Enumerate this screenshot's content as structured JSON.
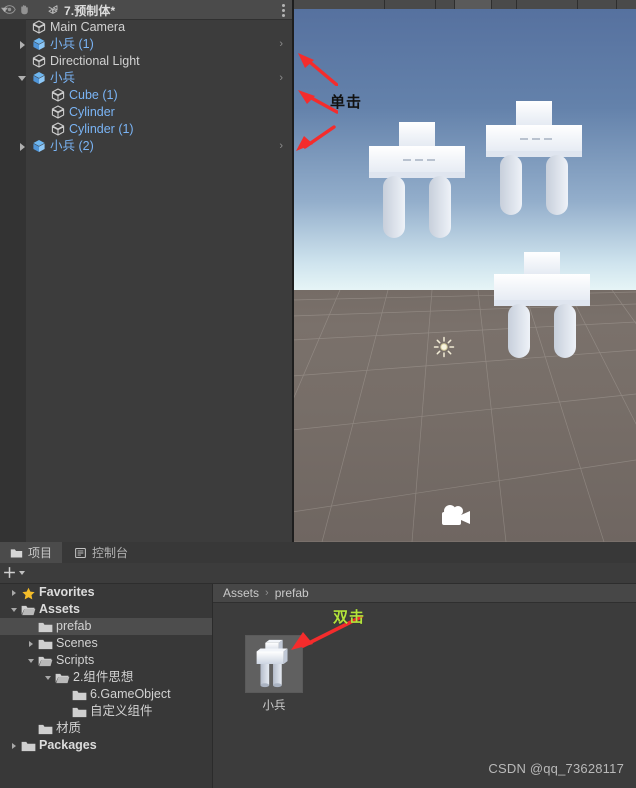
{
  "hierarchy": {
    "header": {
      "title": "7.预制体*",
      "eye_icon": "eye-icon",
      "hand_icon": "hand-icon",
      "dropdown_icon": "chevron-down-icon",
      "scene_icon": "unity-scene-icon",
      "menu_icon": "kebab-menu-icon"
    },
    "items": [
      {
        "label": "Main Camera",
        "indent": 0,
        "twisty": "none",
        "icon": "gameobject-cube-icon",
        "prefab": false,
        "chevron": ""
      },
      {
        "label": "小兵 (1)",
        "indent": 0,
        "twisty": "right",
        "icon": "prefab-cube-icon",
        "prefab": true,
        "chevron": "›"
      },
      {
        "label": "Directional Light",
        "indent": 0,
        "twisty": "none",
        "icon": "gameobject-cube-icon",
        "prefab": false,
        "chevron": ""
      },
      {
        "label": "小兵",
        "indent": 0,
        "twisty": "down",
        "icon": "prefab-cube-icon",
        "prefab": true,
        "chevron": "›"
      },
      {
        "label": "Cube (1)",
        "indent": 1,
        "twisty": "none",
        "icon": "gameobject-cube-icon",
        "prefab": true,
        "chevron": ""
      },
      {
        "label": "Cylinder",
        "indent": 1,
        "twisty": "none",
        "icon": "gameobject-cube-icon",
        "prefab": true,
        "chevron": ""
      },
      {
        "label": "Cylinder (1)",
        "indent": 1,
        "twisty": "none",
        "icon": "gameobject-cube-icon",
        "prefab": true,
        "chevron": ""
      },
      {
        "label": "小兵 (2)",
        "indent": 0,
        "twisty": "right",
        "icon": "prefab-cube-icon",
        "prefab": true,
        "chevron": "›"
      }
    ]
  },
  "scene": {
    "sky_top_color": "#56719F",
    "sky_horizon_color": "#E8F6F7",
    "ground_color": "#786F69",
    "light_gizmo": "directional-light-gizmo",
    "camera_gizmo": "camera-gizmo",
    "characters": 3
  },
  "annotations": {
    "click": {
      "text": "单击",
      "color": "#111111"
    },
    "double_click": {
      "text": "双击",
      "color": "#B3E33B"
    },
    "arrow_color": "#F42C2C"
  },
  "project": {
    "tabs": [
      {
        "label": "项目",
        "icon": "folder-icon",
        "active": true
      },
      {
        "label": "控制台",
        "icon": "console-icon",
        "active": false
      }
    ],
    "toolbar": {
      "add_label": "+",
      "add_icon": "plus-icon",
      "dropdown_icon": "chevron-down-icon"
    },
    "tree": [
      {
        "label": "Favorites",
        "indent": 0,
        "twisty": "right",
        "icon": "star-icon",
        "bold": true,
        "selected": false
      },
      {
        "label": "Assets",
        "indent": 0,
        "twisty": "down",
        "icon": "folder-open-icon",
        "bold": true,
        "selected": false
      },
      {
        "label": "prefab",
        "indent": 1,
        "twisty": "none",
        "icon": "folder-icon",
        "bold": false,
        "selected": true
      },
      {
        "label": "Scenes",
        "indent": 1,
        "twisty": "right",
        "icon": "folder-icon",
        "bold": false,
        "selected": false
      },
      {
        "label": "Scripts",
        "indent": 1,
        "twisty": "down",
        "icon": "folder-open-icon",
        "bold": false,
        "selected": false
      },
      {
        "label": "2.组件思想",
        "indent": 2,
        "twisty": "down",
        "icon": "folder-open-icon",
        "bold": false,
        "selected": false
      },
      {
        "label": "6.GameObject",
        "indent": 3,
        "twisty": "none",
        "icon": "folder-icon",
        "bold": false,
        "selected": false
      },
      {
        "label": "自定义组件",
        "indent": 3,
        "twisty": "none",
        "icon": "folder-icon",
        "bold": false,
        "selected": false
      },
      {
        "label": "材质",
        "indent": 1,
        "twisty": "none",
        "icon": "folder-icon",
        "bold": false,
        "selected": false
      },
      {
        "label": "Packages",
        "indent": 0,
        "twisty": "right",
        "icon": "folder-icon",
        "bold": true,
        "selected": false
      }
    ],
    "breadcrumb": {
      "root": "Assets",
      "separator": "›",
      "current": "prefab"
    },
    "assets": [
      {
        "label": "小兵",
        "icon": "prefab-thumbnail"
      }
    ]
  },
  "watermark": {
    "text": "CSDN @qq_73628117"
  }
}
